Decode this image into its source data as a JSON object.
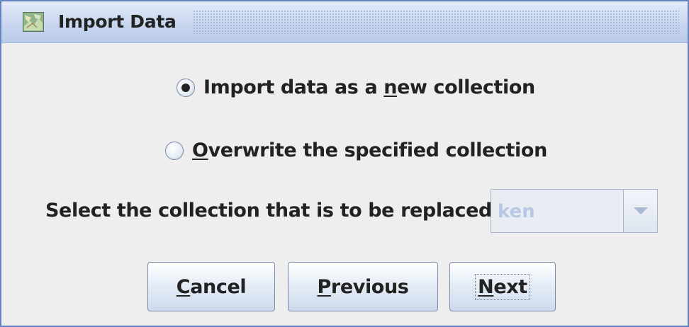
{
  "window": {
    "title": "Import Data"
  },
  "options": {
    "new_collection": {
      "pre": "Import data as a ",
      "mnemonic": "n",
      "post": "ew collection",
      "checked": true
    },
    "overwrite": {
      "pre": "",
      "mnemonic": "O",
      "post": "verwrite the specified collection",
      "checked": false
    }
  },
  "replace": {
    "label": "Select the collection that is to be replaced.",
    "selected_value": "ken",
    "enabled": false
  },
  "buttons": {
    "cancel": {
      "mnemonic": "C",
      "rest": "ancel"
    },
    "previous": {
      "mnemonic": "P",
      "rest": "revious"
    },
    "next": {
      "mnemonic": "N",
      "rest": "ext"
    }
  },
  "colors": {
    "title_gradient_top": "#e3ebf8",
    "title_gradient_bottom": "#b9cae9",
    "window_border": "#6382bf",
    "disabled_text": "#b8c8e2"
  },
  "icons": {
    "window_icon": "application-map-icon",
    "combo_arrow": "chevron-down-icon"
  }
}
